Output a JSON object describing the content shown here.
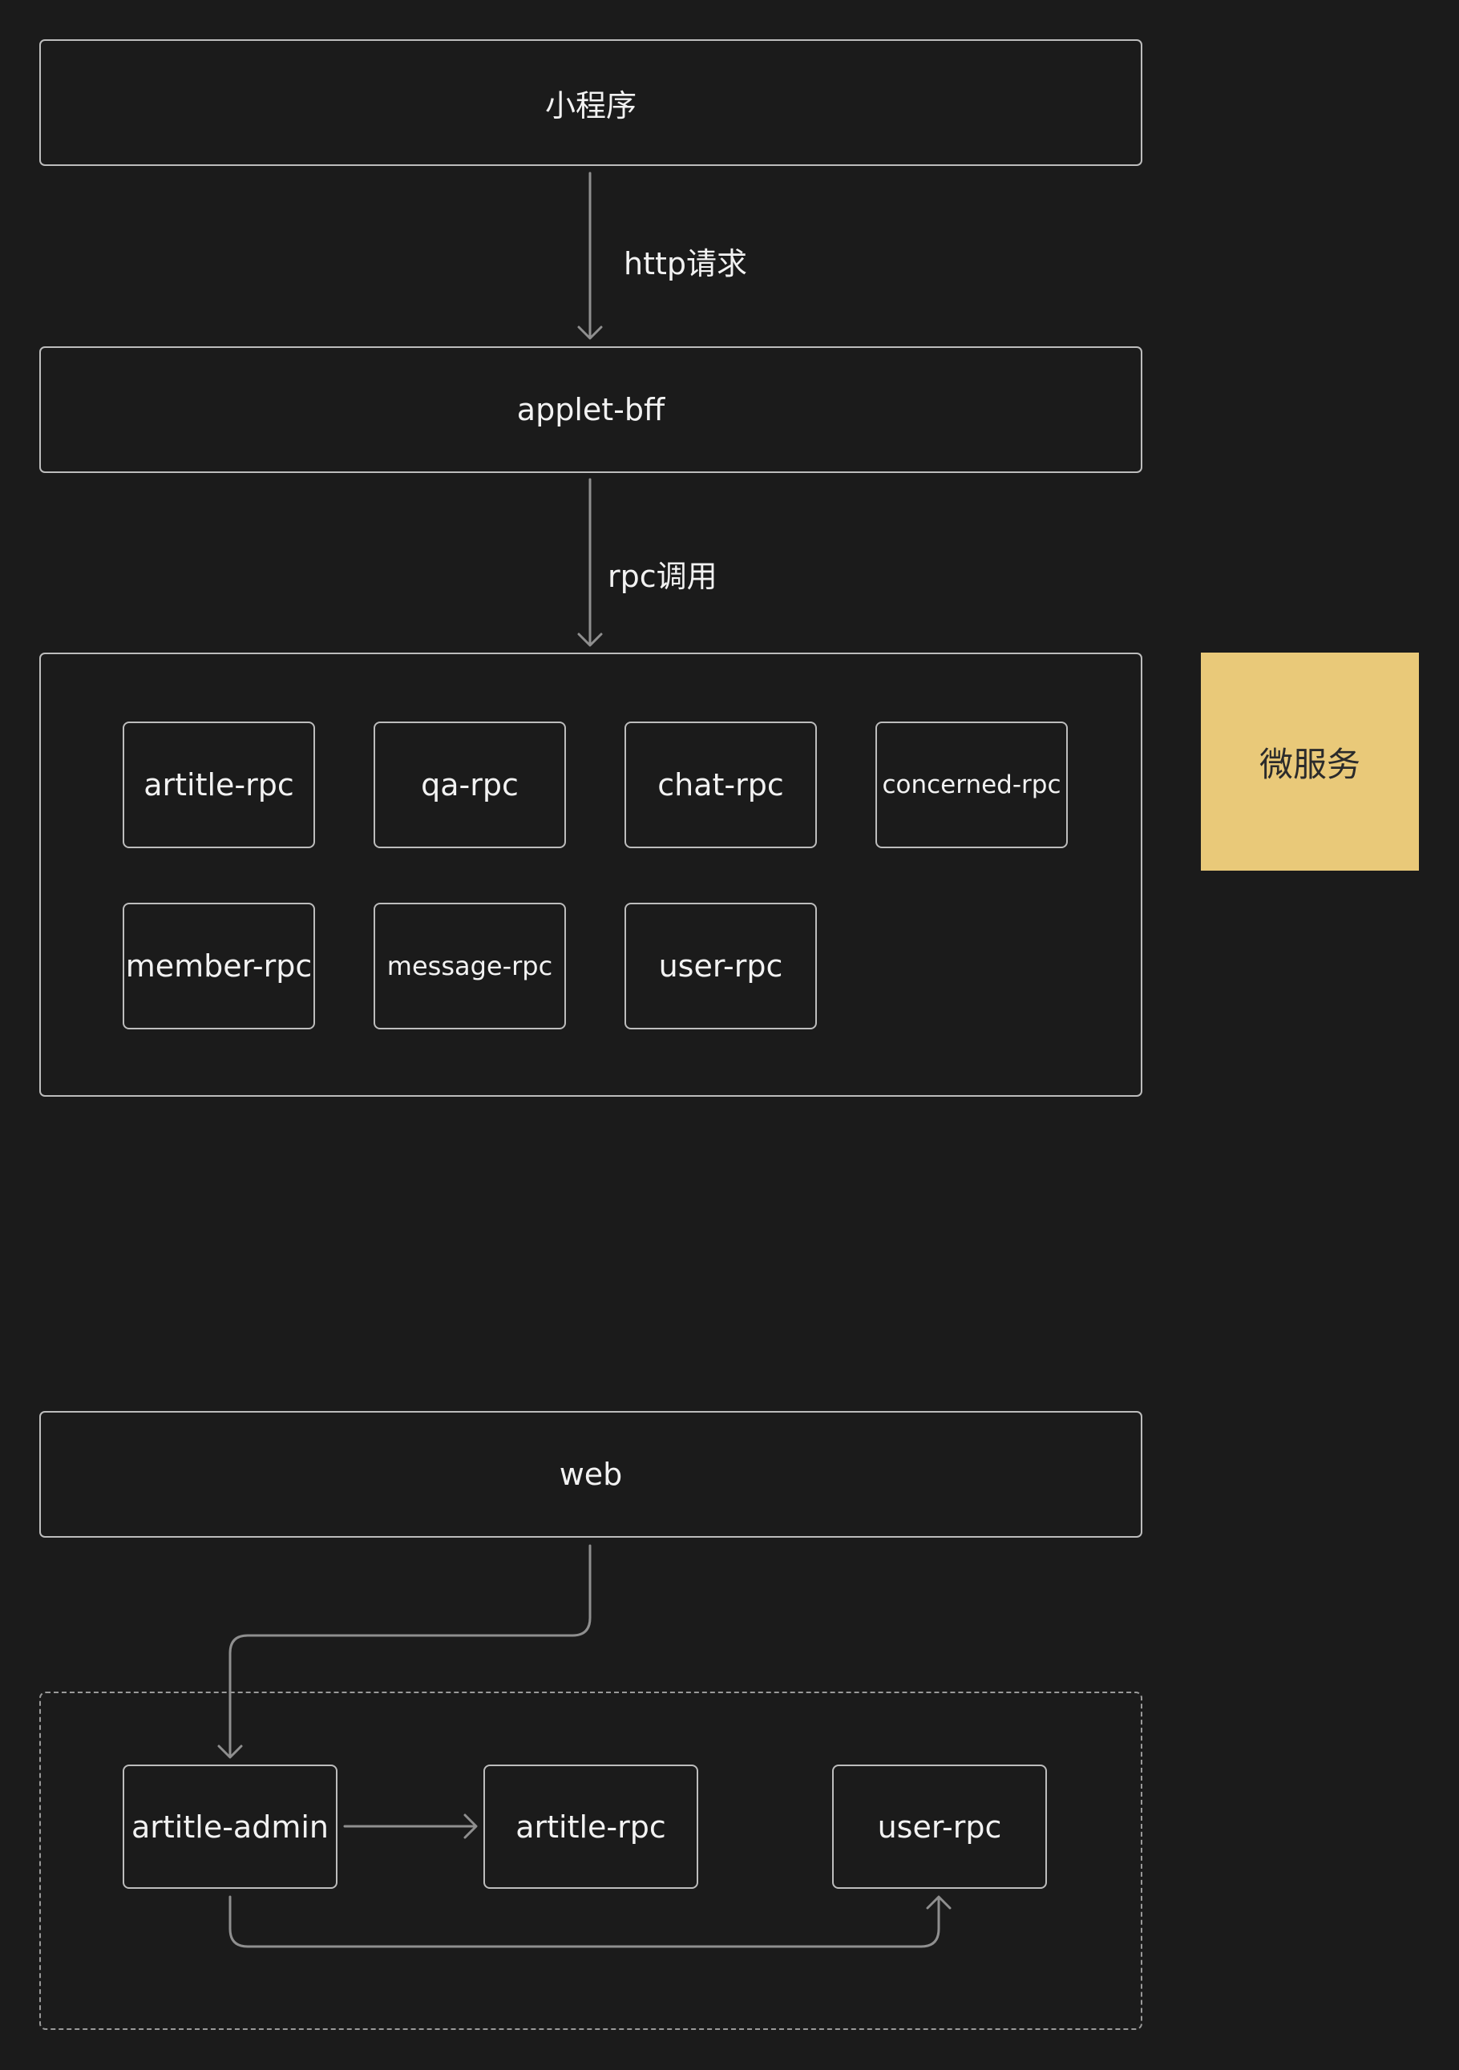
{
  "top_client": {
    "label": "小程序"
  },
  "edge_http": {
    "label": "http请求"
  },
  "bff": {
    "label": "applet-bff"
  },
  "edge_rpc": {
    "label": "rpc调用"
  },
  "microservices": [
    "artitle-rpc",
    "qa-rpc",
    "chat-rpc",
    "concerned-rpc",
    "member-rpc",
    "message-rpc",
    "user-rpc"
  ],
  "side_note": {
    "label": "微服务",
    "color": "#e9c979"
  },
  "web_client": {
    "label": "web"
  },
  "admin_group": {
    "admin": "artitle-admin",
    "article_rpc": "artitle-rpc",
    "user_rpc": "user-rpc"
  }
}
